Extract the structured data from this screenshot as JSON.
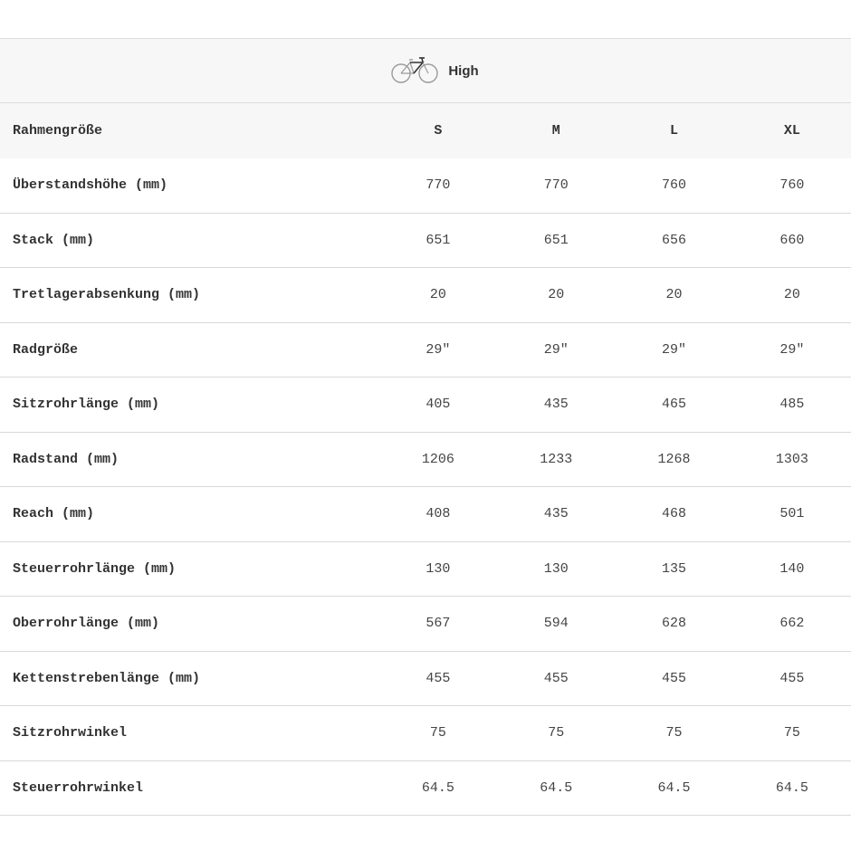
{
  "header": {
    "icon": "bicycle-icon",
    "label": "High"
  },
  "sizes": {
    "label": "Rahmengröße",
    "values": [
      "S",
      "M",
      "L",
      "XL"
    ]
  },
  "rows": [
    {
      "label": "Überstandshöhe (mm)",
      "values": [
        "770",
        "770",
        "760",
        "760"
      ]
    },
    {
      "label": "Stack (mm)",
      "values": [
        "651",
        "651",
        "656",
        "660"
      ]
    },
    {
      "label": "Tretlagerabsenkung (mm)",
      "values": [
        "20",
        "20",
        "20",
        "20"
      ]
    },
    {
      "label": "Radgröße",
      "values": [
        "29\"",
        "29\"",
        "29\"",
        "29\""
      ]
    },
    {
      "label": "Sitzrohrlänge (mm)",
      "values": [
        "405",
        "435",
        "465",
        "485"
      ]
    },
    {
      "label": "Radstand (mm)",
      "values": [
        "1206",
        "1233",
        "1268",
        "1303"
      ]
    },
    {
      "label": "Reach (mm)",
      "values": [
        "408",
        "435",
        "468",
        "501"
      ]
    },
    {
      "label": "Steuerrohrlänge (mm)",
      "values": [
        "130",
        "130",
        "135",
        "140"
      ]
    },
    {
      "label": "Oberrohrlänge (mm)",
      "values": [
        "567",
        "594",
        "628",
        "662"
      ]
    },
    {
      "label": "Kettenstrebenlänge (mm)",
      "values": [
        "455",
        "455",
        "455",
        "455"
      ]
    },
    {
      "label": "Sitzrohrwinkel",
      "values": [
        "75",
        "75",
        "75",
        "75"
      ]
    },
    {
      "label": "Steuerrohrwinkel",
      "values": [
        "64.5",
        "64.5",
        "64.5",
        "64.5"
      ]
    }
  ]
}
